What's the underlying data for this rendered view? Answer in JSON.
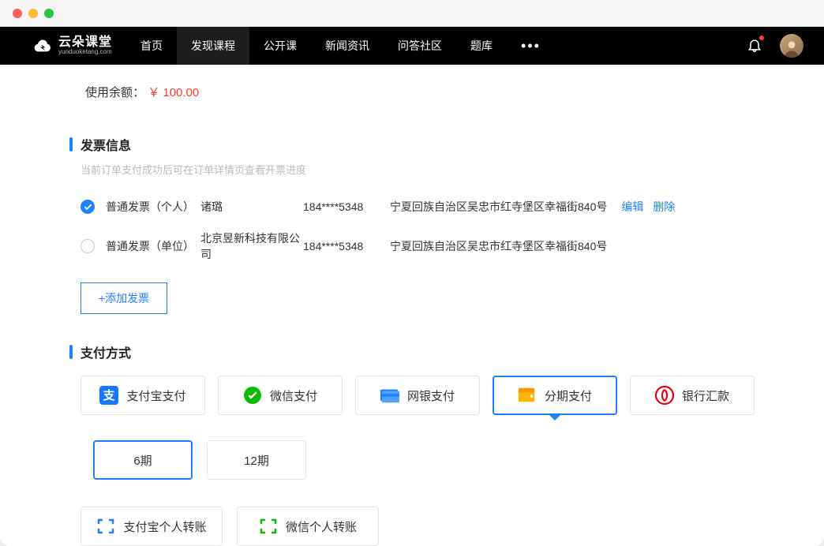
{
  "brand": {
    "name": "云朵课堂",
    "sub": "yunduoketang.com"
  },
  "nav": {
    "items": [
      "首页",
      "发现课程",
      "公开课",
      "新闻资讯",
      "问答社区",
      "题库"
    ],
    "activeIndex": 1
  },
  "balance": {
    "label": "使用余额：",
    "amount": "￥ 100.00"
  },
  "invoice": {
    "title": "发票信息",
    "subtitle": "当前订单支付成功后可在订单详情页查看开票进度",
    "rows": [
      {
        "type": "普通发票（个人）",
        "name": "诸璐",
        "phone": "184****5348",
        "addr": "宁夏回族自治区吴忠市红寺堡区幸福街840号",
        "selected": true
      },
      {
        "type": "普通发票（单位）",
        "name": "北京昱新科技有限公司",
        "phone": "184****5348",
        "addr": "宁夏回族自治区吴忠市红寺堡区幸福街840号",
        "selected": false
      }
    ],
    "editLabel": "编辑",
    "deleteLabel": "删除",
    "addLabel": "+添加发票"
  },
  "payment": {
    "title": "支付方式",
    "options": [
      "支付宝支付",
      "微信支付",
      "网银支付",
      "分期支付",
      "银行汇款"
    ],
    "selectedIndex": 3,
    "terms": [
      "6期",
      "12期"
    ],
    "selectedTermIndex": 0,
    "transfers": [
      "支付宝个人转账",
      "微信个人转账"
    ]
  }
}
